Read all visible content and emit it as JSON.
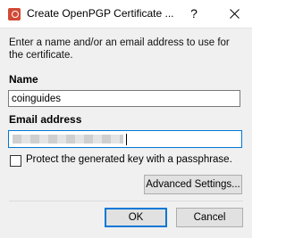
{
  "window": {
    "title": "Create OpenPGP Certificate ...",
    "help_glyph": "?",
    "close_icon": "close-icon",
    "app_icon": "kleopatra-icon"
  },
  "form": {
    "instructions": "Enter a name and/or an email address to use for the certificate.",
    "name_label": "Name",
    "name_value": "coinguides",
    "email_label": "Email address",
    "email_value": "",
    "passphrase_label": "Protect the generated key with a passphrase.",
    "passphrase_checked": false
  },
  "buttons": {
    "advanced": "Advanced Settings...",
    "ok": "OK",
    "cancel": "Cancel"
  },
  "colors": {
    "focus_border": "#0078d7",
    "app_icon": "#d24a36"
  }
}
